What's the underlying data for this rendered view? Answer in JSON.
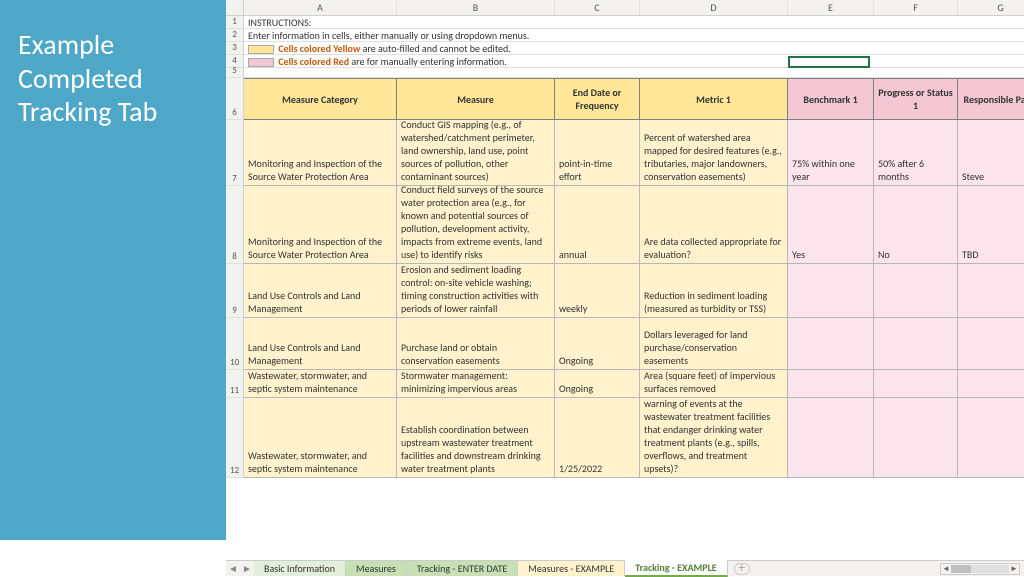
{
  "title_lines": [
    "Example",
    "Completed",
    "Tracking Tab"
  ],
  "col_letters": [
    "A",
    "B",
    "C",
    "D",
    "E",
    "F",
    "G"
  ],
  "instructions": {
    "r1": "INSTRUCTIONS:",
    "r2": "Enter information in cells, either manually or using dropdown menus.",
    "r3_label": "Cells colored Yellow",
    "r3_rest": " are auto-filled and cannot be edited.",
    "r4_label": "Cells colored Red",
    "r4_rest": " are for manually entering information."
  },
  "headers": {
    "A": "Measure Category",
    "B": "Measure",
    "C": "End Date or Frequency",
    "D": "Metric 1",
    "E": "Benchmark 1",
    "F": "Progress or Status 1",
    "G": "Responsible Party"
  },
  "rows": [
    {
      "n": 7,
      "h": 66,
      "A": "Monitoring and Inspection of the Source Water Protection Area",
      "B": "Conduct GIS mapping (e.g., of watershed/catchment perimeter, land ownership, land use, point sources of pollution, other contaminant sources)",
      "C": "point-in-time effort",
      "D": "Percent of watershed area mapped for desired features (e.g., tributaries, major landowners, conservation easements)",
      "E": "75% within one year",
      "F": "50% after 6 months",
      "G": "Steve"
    },
    {
      "n": 8,
      "h": 78,
      "A": "Monitoring and Inspection of the Source Water Protection Area",
      "B": "Conduct field surveys of the source water protection area (e.g., for known and potential sources of pollution, development activity, impacts from extreme events, land use) to identify risks",
      "C": "annual",
      "D": "Are data collected appropriate for evaluation?",
      "E": "Yes",
      "F": "No",
      "G": "TBD"
    },
    {
      "n": 9,
      "h": 54,
      "A": "Land Use Controls and Land Management",
      "B": "Erosion and sediment loading control: on-site vehicle washing; timing construction activities with periods of lower rainfall",
      "C": "weekly",
      "D": "Reduction in sediment loading (measured as turbidity or TSS)",
      "E": "",
      "F": "",
      "G": ""
    },
    {
      "n": 10,
      "h": 52,
      "A": "Land Use Controls and Land Management",
      "B": "Purchase land or obtain conservation easements",
      "C": "Ongoing",
      "D": "Dollars leveraged for land purchase/conservation easements",
      "E": "",
      "F": "",
      "G": ""
    },
    {
      "n": 11,
      "h": 28,
      "A": "Wastewater, stormwater, and septic system maintenance",
      "B": "Stormwater management: minimizing impervious areas",
      "C": "Ongoing",
      "D": "Area (square feet) of impervious surfaces removed",
      "E": "",
      "F": "",
      "G": ""
    },
    {
      "n": 12,
      "h": 80,
      "A": "Wastewater, stormwater, and septic system maintenance",
      "B": "Establish coordination between upstream wastewater treatment facilities and downstream drinking water treatment plants",
      "C": "1/25/2022",
      "D": "Are there agreements regarding warning of events at the wastewater treatment facilities that endanger drinking water treatment plants (e.g., spills, overflows, and treatment upsets)?",
      "E": "",
      "F": "",
      "G": ""
    }
  ],
  "tabs": {
    "t1": "Basic Information",
    "t2": "Measures",
    "t3": "Tracking - ENTER DATE",
    "t4": "Measures - EXAMPLE",
    "t5": "Tracking - EXAMPLE"
  },
  "row_heights_top": {
    "r1": 13,
    "r2": 13,
    "r3": 13,
    "r4": 13,
    "r5": 10,
    "r6": 42
  }
}
